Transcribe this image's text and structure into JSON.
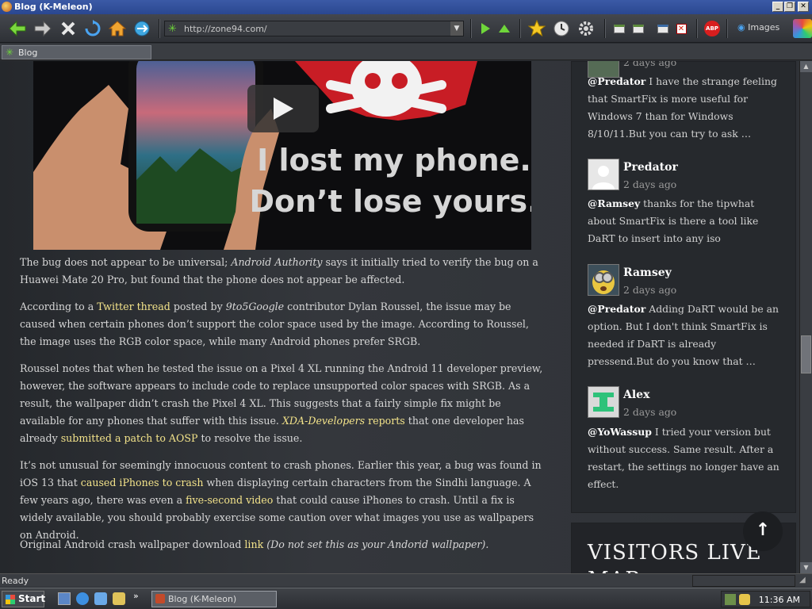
{
  "window": {
    "title": "Blog (K-Meleon)"
  },
  "toolbar": {
    "url": "http://zone94.com/",
    "images_label": "Images",
    "adblock_label": "ABP"
  },
  "tabs": [
    {
      "label": "Blog"
    }
  ],
  "video": {
    "line1": "I lost my phone.",
    "line2": "Don’t lose yours."
  },
  "article": {
    "p1": {
      "pre": "The bug does not appear to be universal; ",
      "em": "Android Authority",
      "post": " says it initially tried to verify the bug on a Huawei Mate 20 Pro, but found that the phone does not appear be affected."
    },
    "p2": {
      "a": "According to a ",
      "link1": "Twitter thread",
      "b": " posted by ",
      "em": "9to5Google",
      "c": " contributor Dylan Roussel, the issue may be caused when certain phones don’t support the color space used by the image. According to Roussel, the image uses the RGB color space, while many Android phones prefer SRGB."
    },
    "p3": {
      "a": "Roussel notes that when he tested the issue on a Pixel 4 XL running the Android 11 developer preview, however, the software appears to include code to replace unsupported color spaces with SRGB. As a result, the wallpaper didn’t crash the Pixel 4 XL. This suggests that a fairly simple fix might be available for any phones that suffer with this issue. ",
      "link_em": "XDA-Developers",
      "link1": " reports",
      "b": " that one developer has already ",
      "link2": "submitted a patch to AOSP",
      "c": " to resolve the issue."
    },
    "p4": {
      "a": "It’s not unusual for seemingly innocuous content to crash phones. Earlier this year, a bug was found in iOS 13 that ",
      "link1": "caused iPhones to crash",
      "b": " when displaying certain characters from the Sindhi language. A few years ago, there was even a ",
      "link2": "five-second video",
      "c": " that could cause iPhones to crash. Until a fix is widely available, you should probably exercise some caution over what images you use as wallpapers on Android."
    },
    "p5": {
      "a": "Original Android crash wallpaper download ",
      "link1": "link",
      "em": " (Do not set this as your Andorid wallpaper)."
    }
  },
  "sidebar": {
    "top_date": "2 days ago",
    "c1": {
      "mention": "@Predator",
      "text": " I have the strange feeling that SmartFix is more useful for Windows 7 than for Windows 8/10/11.But you can try to ask …"
    },
    "c2": {
      "name": "Predator",
      "date": "2 days ago",
      "mention": "@Ramsey",
      "text": " thanks for the tipwhat about SmartFix is there a tool like DaRT to insert into any iso"
    },
    "c3": {
      "name": "Ramsey",
      "date": "2 days ago",
      "mention": "@Predator",
      "text": " Adding DaRT would be an option. But I don't think SmartFix is needed if DaRT is already pressend.But do you know that …"
    },
    "c4": {
      "name": "Alex",
      "date": "2 days ago",
      "mention": "@YoWassup",
      "text": " I tried your version but without success. Same result. After a restart, the settings no longer have an effect."
    },
    "visitors": "VISITORS LIVE MAP"
  },
  "status": {
    "text": "Ready"
  },
  "taskbar": {
    "start": "Start",
    "task": "Blog (K-Meleon)",
    "clock": "11:36 AM"
  },
  "colors": {
    "link": "#f3e38a",
    "background": "#2b2e33",
    "titlebar": "#2a4790"
  }
}
